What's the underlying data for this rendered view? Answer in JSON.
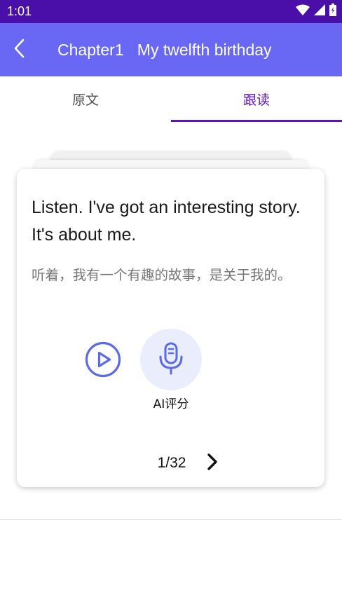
{
  "status_bar": {
    "time": "1:01",
    "icons": [
      "wifi-icon",
      "cellular-signal-icon",
      "battery-icon"
    ]
  },
  "app_bar": {
    "back_icon": "chevron-left-icon",
    "title": "Chapter1   My twelfth birthday"
  },
  "tabs": [
    {
      "label": "原文",
      "selected": false
    },
    {
      "label": "跟读",
      "selected": true
    }
  ],
  "card": {
    "sentence_en": "Listen. I've got an interesting story. It's about me.",
    "sentence_cn": "听着，我有一个有趣的故事，是关于我的。",
    "play_icon": "play-circle-icon",
    "mic_icon": "microphone-icon",
    "ai_label": "AI评分",
    "page_indicator": "1/32",
    "next_icon": "chevron-right-icon"
  },
  "colors": {
    "status_bar": "#4a0fa8",
    "app_bar": "#6868f4",
    "tab_active": "#5b12c9",
    "icon_accent": "#5b6ae6",
    "mic_bg": "#eaedfb"
  }
}
